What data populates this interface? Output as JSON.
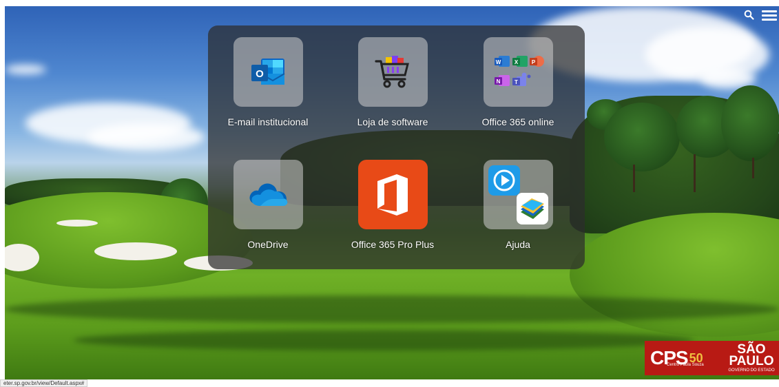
{
  "header": {
    "search_icon": "search-icon",
    "menu_icon": "hamburger-menu-icon"
  },
  "apps": [
    {
      "label": "E-mail institucional",
      "icon": "outlook-icon"
    },
    {
      "label": "Loja de software",
      "icon": "shopping-cart-icon"
    },
    {
      "label": "Office 365 online",
      "icon": "office-apps-grid-icon"
    },
    {
      "label": "OneDrive",
      "icon": "onedrive-cloud-icon"
    },
    {
      "label": "Office 365 Pro Plus",
      "icon": "office-logo-icon"
    },
    {
      "label": "Ajuda",
      "icon": "help-video-book-icon"
    }
  ],
  "footer_logos": {
    "cps": "CPS",
    "cps_50": "50",
    "cps_small": "Centro Paula Souza",
    "sp_name": "SÃO PAULO",
    "sp_sub": "GOVERNO DO ESTADO"
  },
  "statusbar": {
    "url": "eter.sp.gov.br/view/Default.aspx#"
  },
  "colors": {
    "panel_bg": "rgba(45,45,45,0.72)",
    "office_red": "#e84a17",
    "logo_red": "#b81a14"
  }
}
